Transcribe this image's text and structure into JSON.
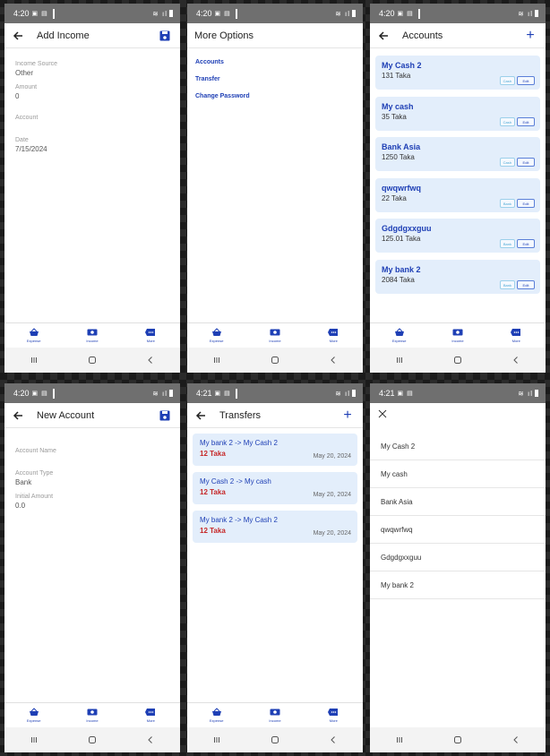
{
  "status": {
    "time_a": "4:20",
    "time_b": "4:21"
  },
  "colors": {
    "primary": "#1e3fb5",
    "card_bg": "#e3eefb",
    "amount_red": "#c62828",
    "statusbar": "#6f6f6f"
  },
  "bottom_nav": [
    {
      "label": "Expense",
      "icon": "basket-icon"
    },
    {
      "label": "Income",
      "icon": "cash-icon"
    },
    {
      "label": "More",
      "icon": "more-icon"
    }
  ],
  "add_income": {
    "title": "Add Income",
    "fields": [
      {
        "label": "Income Source",
        "value": "Other"
      },
      {
        "label": "Amount",
        "value": "0"
      },
      {
        "label": "Account",
        "value": ""
      },
      {
        "label": "Date",
        "value": "7/15/2024"
      }
    ]
  },
  "more_options": {
    "title": "More Options",
    "links": [
      "Accounts",
      "Transfer",
      "Change Password"
    ]
  },
  "accounts": {
    "title": "Accounts",
    "items": [
      {
        "name": "My Cash 2",
        "balance": "131 Taka",
        "type": "Cash",
        "edit": "Edit"
      },
      {
        "name": "My cash",
        "balance": "35 Taka",
        "type": "Cash",
        "edit": "Edit"
      },
      {
        "name": "Bank Asia",
        "balance": "1250 Taka",
        "type": "Cash",
        "edit": "Edit"
      },
      {
        "name": "qwqwrfwq",
        "balance": "22 Taka",
        "type": "Bank",
        "edit": "Edit"
      },
      {
        "name": "Gdgdgxxguu",
        "balance": "125.01 Taka",
        "type": "Bank",
        "edit": "Edit"
      },
      {
        "name": "My bank 2",
        "balance": "2084 Taka",
        "type": "Bank",
        "edit": "Edit"
      }
    ]
  },
  "new_account": {
    "title": "New Account",
    "fields": [
      {
        "label": "Account Name",
        "value": ""
      },
      {
        "label": "Account Type",
        "value": "Bank"
      },
      {
        "label": "Initial Amount",
        "value": "0.0"
      }
    ]
  },
  "transfers": {
    "title": "Transfers",
    "items": [
      {
        "route": "My bank 2 -> My Cash 2",
        "amount": "12 Taka",
        "date": "May 20, 2024"
      },
      {
        "route": "My Cash 2 -> My cash",
        "amount": "12 Taka",
        "date": "May 20, 2024"
      },
      {
        "route": "My bank 2 -> My Cash 2",
        "amount": "12 Taka",
        "date": "May 20, 2024"
      }
    ]
  },
  "account_picker": {
    "options": [
      "My Cash 2",
      "My cash",
      "Bank Asia",
      "qwqwrfwq",
      "Gdgdgxxguu",
      "My bank 2"
    ]
  }
}
